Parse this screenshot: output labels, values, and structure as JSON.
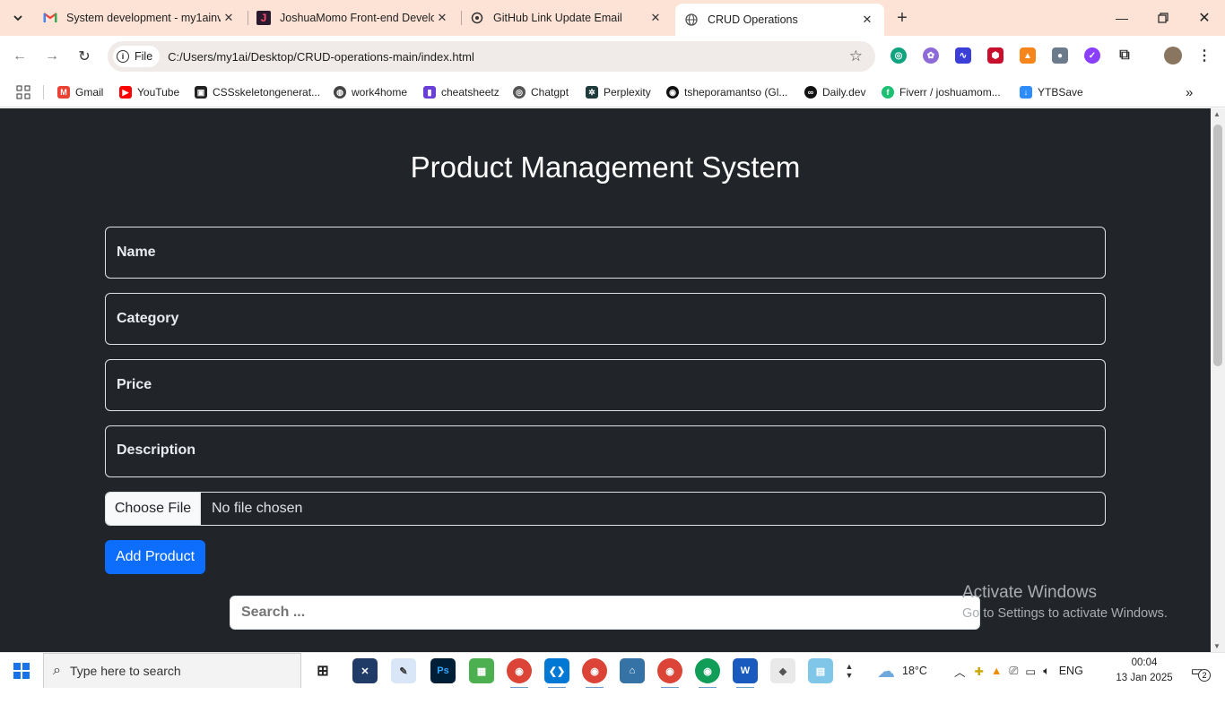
{
  "browser": {
    "tabs": [
      {
        "title": "System development - my1ainv",
        "favicon": "gmail-icon",
        "active": false
      },
      {
        "title": "JoshuaMomo Front-end Develo",
        "favicon": "j-logo-icon",
        "active": false
      },
      {
        "title": "GitHub Link Update Email",
        "favicon": "chatgpt-icon",
        "active": false
      },
      {
        "title": "CRUD Operations",
        "favicon": "globe-icon",
        "active": true
      }
    ],
    "chip_label": "File",
    "url": "C:/Users/my1ai/Desktop/CRUD-operations-main/index.html",
    "bookmarks": [
      "Gmail",
      "YouTube",
      "CSSskeletongenerat...",
      "work4home",
      "cheatsheetz",
      "Chatgpt",
      "Perplexity",
      "tsheporamantso (Gl...",
      "Daily.dev",
      "Fiverr / joshuamom...",
      "YTBSave"
    ]
  },
  "page": {
    "title": "Product Management System",
    "form": {
      "name_placeholder": "Name",
      "category_placeholder": "Category",
      "price_placeholder": "Price",
      "description_placeholder": "Description",
      "file_button": "Choose File",
      "file_status": "No file chosen",
      "submit_label": "Add Product"
    },
    "search_placeholder": "Search ..."
  },
  "watermark": {
    "line1": "Activate Windows",
    "line2": "Go to Settings to activate Windows."
  },
  "taskbar": {
    "search_placeholder": "Type here to search",
    "weather": "18°C",
    "language": "ENG",
    "time": "00:04",
    "date": "13 Jan 2025",
    "notification_count": "2"
  },
  "colors": {
    "page_bg": "#212529",
    "primary_button": "#0d6efd",
    "tabstrip_bg": "#fde3d6"
  }
}
